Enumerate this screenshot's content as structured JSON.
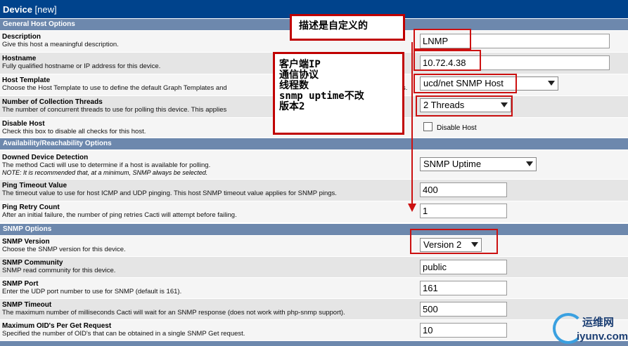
{
  "header": {
    "title": "Device",
    "tag": "[new]"
  },
  "sections": {
    "general": "General Host Options",
    "availability": "Availability/Reachability Options",
    "snmp": "SNMP Options"
  },
  "fields": {
    "description": {
      "title": "Description",
      "desc": "Give this host a meaningful description.",
      "value": "LNMP"
    },
    "hostname": {
      "title": "Hostname",
      "desc": "Fully qualified hostname or IP address for this device.",
      "value": "10.72.4.38"
    },
    "host_template": {
      "title": "Host Template",
      "desc": "Choose the Host Template to use to define the default Graph Templates and",
      "desc_tail": "s.",
      "value": "ucd/net SNMP Host"
    },
    "threads": {
      "title": "Number of Collection Threads",
      "desc": "The number of concurrent threads to use for polling this device. This applies",
      "value": "2 Threads"
    },
    "disable_host": {
      "title": "Disable Host",
      "desc": "Check this box to disable all checks for this host.",
      "checkbox_label": "Disable Host"
    },
    "downed_detection": {
      "title": "Downed Device Detection",
      "desc": "The method Cacti will use to determine if a host is available for polling.",
      "note": "NOTE: It is recommended that, at a minimum, SNMP always be selected.",
      "value": "SNMP Uptime"
    },
    "ping_timeout": {
      "title": "Ping Timeout Value",
      "desc": "The timeout value to use for host ICMP and UDP pinging. This host SNMP timeout value applies for SNMP pings.",
      "value": "400"
    },
    "ping_retry": {
      "title": "Ping Retry Count",
      "desc": "After an initial failure, the number of ping retries Cacti will attempt before failing.",
      "value": "1"
    },
    "snmp_version": {
      "title": "SNMP Version",
      "desc": "Choose the SNMP version for this device.",
      "value": "Version 2"
    },
    "snmp_community": {
      "title": "SNMP Community",
      "desc": "SNMP read community for this device.",
      "value": "public"
    },
    "snmp_port": {
      "title": "SNMP Port",
      "desc": "Enter the UDP port number to use for SNMP (default is 161).",
      "value": "161"
    },
    "snmp_timeout": {
      "title": "SNMP Timeout",
      "desc": "The maximum number of milliseconds Cacti will wait for an SNMP response (does not work with php-snmp support).",
      "value": "500"
    },
    "max_oids": {
      "title": "Maximum OID's Per Get Request",
      "desc": "Specified the number of OID's that can be obtained in a single SNMP Get request.",
      "value": "10"
    }
  },
  "annotations": {
    "top_note": "描述是自定义的",
    "side_note": [
      "客户端IP",
      "通信协议",
      "线程数",
      "snmp uptime不改",
      "版本2"
    ]
  },
  "watermark": {
    "line1": "运维网",
    "line2": "iyunv.com"
  },
  "colors": {
    "header": "#00438c",
    "section": "#6d88ad",
    "annotation": "#cc1111"
  }
}
